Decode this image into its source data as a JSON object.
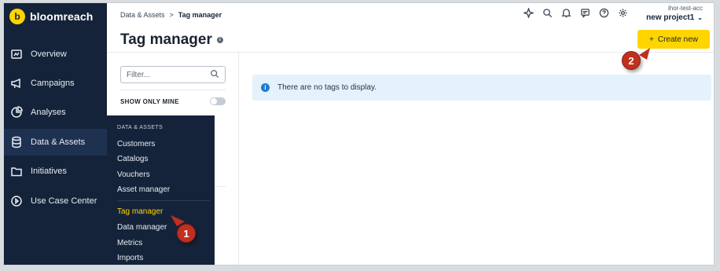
{
  "app": {
    "logo_letter": "b",
    "name": "bloomreach"
  },
  "sidebar": {
    "items": [
      {
        "label": "Overview",
        "icon": "overview-icon"
      },
      {
        "label": "Campaigns",
        "icon": "megaphone-icon"
      },
      {
        "label": "Analyses",
        "icon": "pie-chart-icon"
      },
      {
        "label": "Data & Assets",
        "icon": "database-icon",
        "active": true
      },
      {
        "label": "Initiatives",
        "icon": "folder-icon"
      },
      {
        "label": "Use Case Center",
        "icon": "play-circle-icon"
      }
    ]
  },
  "breadcrumb": {
    "parent": "Data & Assets",
    "separator": ">",
    "current": "Tag manager"
  },
  "topbar": {
    "icons": [
      "sparkle-icon",
      "search-icon",
      "bell-icon",
      "chat-icon",
      "help-icon",
      "settings-icon"
    ],
    "account_name": "ihor-test-acc",
    "project_name": "new project1"
  },
  "page": {
    "title": "Tag manager",
    "info_glyph": "i",
    "create_button": {
      "plus": "+",
      "label": "Create new"
    }
  },
  "filter": {
    "placeholder": "Filter...",
    "show_only_mine": "SHOW ONLY MINE"
  },
  "banner": {
    "icon_glyph": "i",
    "text": "There are no tags to display."
  },
  "flyout": {
    "heading": "DATA & ASSETS",
    "items": [
      {
        "label": "Customers"
      },
      {
        "label": "Catalogs"
      },
      {
        "label": "Vouchers"
      },
      {
        "label": "Asset manager"
      },
      {
        "label": "Tag manager",
        "active": true
      },
      {
        "label": "Data manager"
      },
      {
        "label": "Metrics"
      },
      {
        "label": "Imports"
      }
    ]
  },
  "annotations": {
    "step1": "1",
    "step2": "2"
  },
  "colors": {
    "sidebar": "#15233a",
    "accent": "#ffd500",
    "info": "#1f7cd1",
    "badge": "#c12f1f"
  }
}
